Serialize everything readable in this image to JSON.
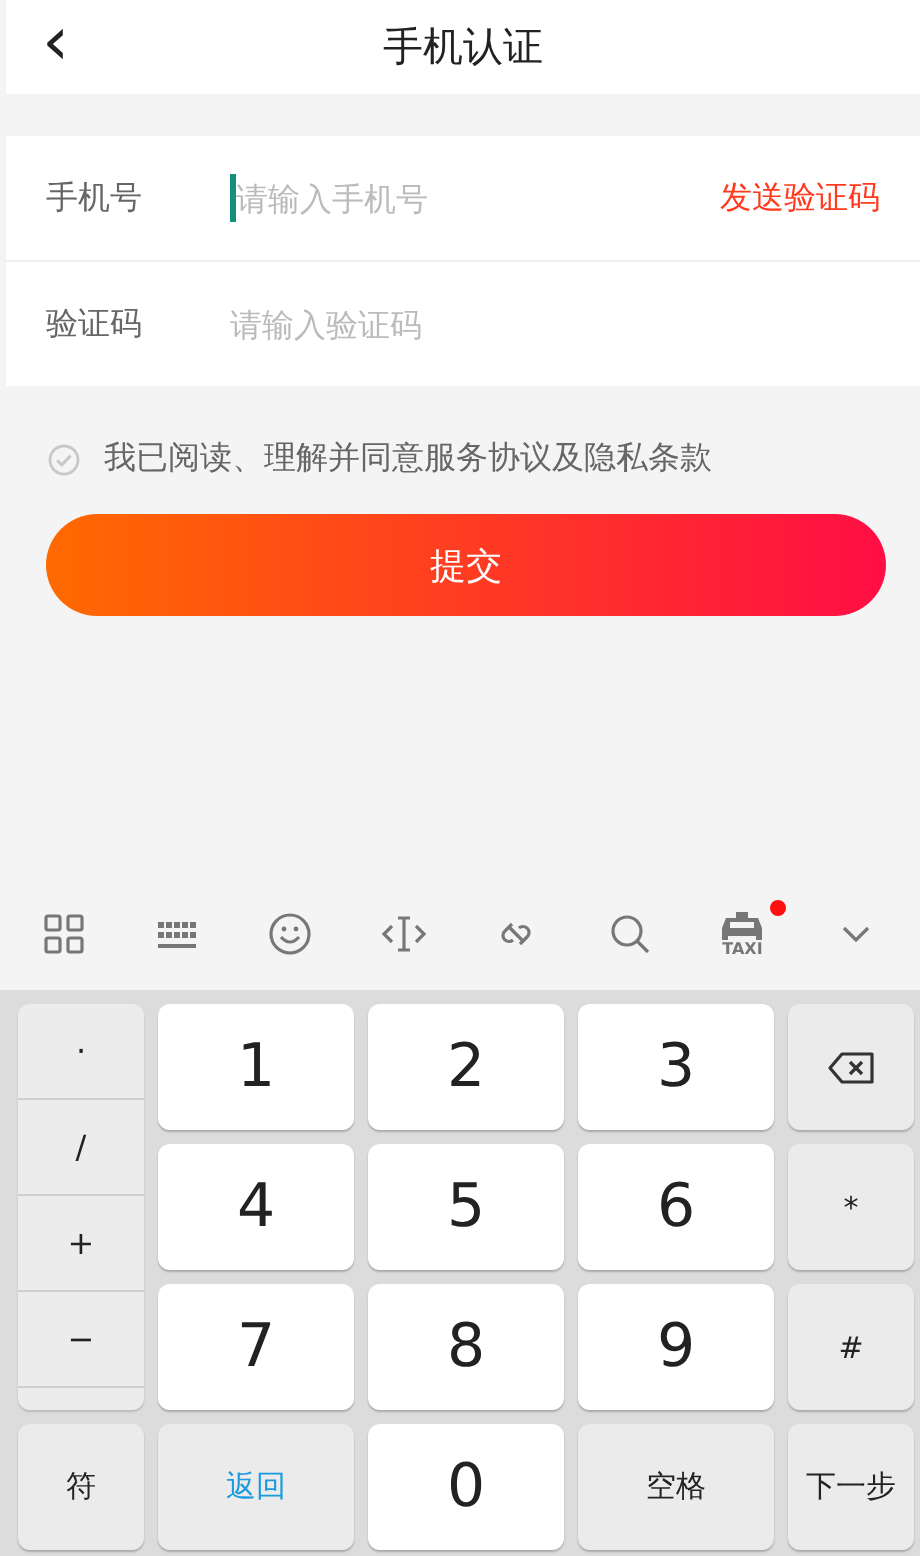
{
  "header": {
    "back": "‹",
    "title": "手机认证"
  },
  "fields": [
    {
      "label": "手机号",
      "placeholder": "请输入手机号",
      "focused": true,
      "action": "发送验证码"
    },
    {
      "label": "验证码",
      "placeholder": "请输入验证码",
      "focused": false
    }
  ],
  "agreement": {
    "checked": false,
    "text": "我已阅读、理解并同意服务协议及隐私条款"
  },
  "submit": "提交",
  "toolbar": [
    {
      "kind": "grid"
    },
    {
      "kind": "keyboard"
    },
    {
      "kind": "emoji"
    },
    {
      "kind": "cursor"
    },
    {
      "kind": "link"
    },
    {
      "kind": "search"
    },
    {
      "kind": "taxi",
      "label": "TAXI",
      "badge": true
    },
    {
      "kind": "collapse"
    }
  ],
  "keyboard": {
    "symbols": [
      "·",
      "/",
      "+",
      "−"
    ],
    "keys": [
      {
        "kind": "digit",
        "label": "1"
      },
      {
        "kind": "digit",
        "label": "2"
      },
      {
        "kind": "digit",
        "label": "3"
      },
      {
        "kind": "delete"
      },
      {
        "kind": "digit",
        "label": "4"
      },
      {
        "kind": "digit",
        "label": "5"
      },
      {
        "kind": "digit",
        "label": "6"
      },
      {
        "kind": "function",
        "label": "*"
      },
      {
        "kind": "digit",
        "label": "7"
      },
      {
        "kind": "digit",
        "label": "8"
      },
      {
        "kind": "digit",
        "label": "9"
      },
      {
        "kind": "function",
        "label": "#"
      },
      {
        "kind": "function",
        "label": "符"
      },
      {
        "kind": "accent",
        "label": "返回"
      },
      {
        "kind": "digit",
        "label": "0"
      },
      {
        "kind": "function",
        "label": "空格"
      },
      {
        "kind": "function",
        "label": "下一步"
      }
    ]
  }
}
